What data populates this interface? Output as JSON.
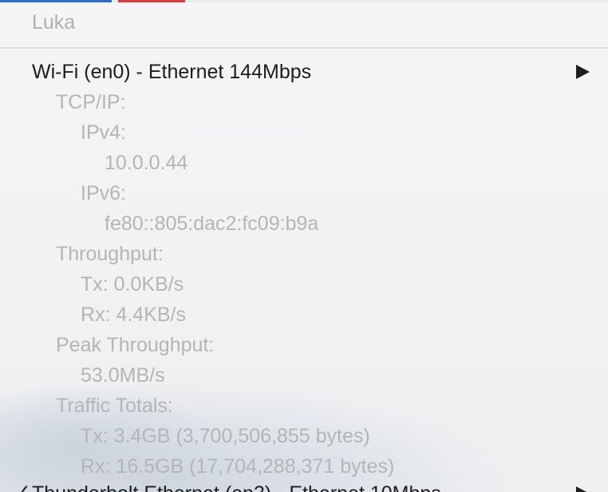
{
  "menu": {
    "section_header": "Luka",
    "interface": {
      "title": "Wi-Fi (en0) - Ethernet 144Mbps"
    },
    "details": {
      "tcpip_label": "TCP/IP:",
      "ipv4_label": "IPv4:",
      "ipv4_value": "10.0.0.44",
      "ipv6_label": "IPv6:",
      "ipv6_value": "fe80::805:dac2:fc09:b9a",
      "throughput_label": "Throughput:",
      "tx_rate": "Tx: 0.0KB/s",
      "rx_rate": "Rx: 4.4KB/s",
      "peak_label": "Peak Throughput:",
      "peak_value": "53.0MB/s",
      "traffic_label": "Traffic Totals:",
      "tx_total": "Tx: 3.4GB (3,700,506,855 bytes)",
      "rx_total": "Rx: 16.5GB (17,704,288,371 bytes)"
    },
    "next_interface": {
      "title": "Thunderbolt Ethernet (en3) - Ethernet 10Mbps"
    }
  },
  "colors": {
    "accent_blue": "#2d6bd3",
    "accent_red": "#e23a3a",
    "text_active": "#1c1c1c",
    "text_disabled": "#b4b5b6"
  }
}
